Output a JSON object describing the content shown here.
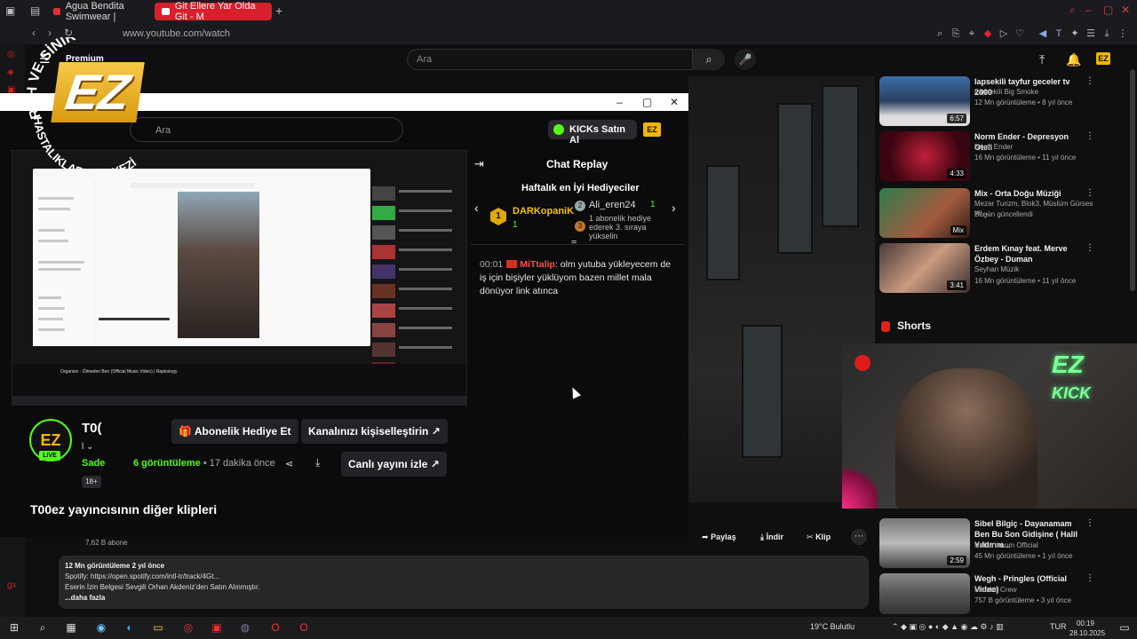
{
  "browser": {
    "tabs": [
      {
        "label": "Agua Bendita Swimwear |"
      },
      {
        "label": "Git Ellere Yar Olda Git - M"
      }
    ],
    "url": "www.youtube.com/watch"
  },
  "youtube": {
    "search_placeholder": "Ara",
    "premium_label": "Premium",
    "recommendations": [
      {
        "title": "lapsekili tayfur geceler tv 2000",
        "channel": "Lapsekili Big Smoke",
        "meta": "12 Mn görüntüleme • 8 yıl önce",
        "duration": "6:57"
      },
      {
        "title": "Norm Ender - Depresyon Oteli",
        "channel": "Norm Ender",
        "meta": "16 Mn görüntüleme • 11 yıl önce",
        "duration": "4:33"
      },
      {
        "title": "Mix - Orta Doğu Müziği",
        "channel": "Mezar Turizm, Blok3, Müslüm Gürses ve ...",
        "meta": "Bugün güncellendi",
        "duration": "Mix"
      },
      {
        "title": "Erdem Kınay feat. Merve Özbey - Duman",
        "channel": "Seyhan Müzik",
        "meta": "16 Mn görüntüleme • 11 yıl önce",
        "duration": "3:41"
      },
      {
        "title": "Sibel Bilgiç - Dayanamam Ben Bu Son Gidişine ( Halil Yıldırım...",
        "channel": "Halil Yıldırım Official",
        "meta": "45 Mn görüntüleme • 1 yıl önce",
        "duration": "2:59"
      },
      {
        "title": "Wegh - Pringles (Official Video)",
        "channel": "Mamba Crew",
        "meta": "757 B görüntüleme • 3 yıl önce",
        "duration": ""
      }
    ],
    "shorts_label": "Shorts",
    "subscribers": "7,62 B abone",
    "actions": {
      "share": "Paylaş",
      "download": "İndir",
      "clip": "Klip"
    },
    "description": {
      "line1": "12 Mn görüntüleme  2 yıl önce",
      "line2": "Spotify: https://open.spotify.com/intl-tr/track/4Gt...",
      "line3": "Eserin İzin Belgesi Sevgili Orhan Akdeniz'den Satın Alınmıştır.",
      "more": "...daha fazla"
    }
  },
  "logo": {
    "text_top": "RUH VE SİNİR",
    "text_side": "HASTALIKLARI MERKEZİ",
    "mark": "EZ"
  },
  "kick": {
    "search_placeholder": "Ara",
    "kicks_button": "KICKs Satın Al",
    "chat": {
      "title": "Chat Replay",
      "top_gifters_title": "Haftalık en İyi Hediyeciler",
      "gifter1": {
        "rank": "1",
        "name": "DARKopaniK",
        "count": "1"
      },
      "gifter2": {
        "rank": "2",
        "name": "Ali_eren24",
        "count": "1"
      },
      "gifter3": {
        "rank": "3",
        "text": "1 abonelik hediye ederek 3. sıraya yükselin"
      },
      "message": {
        "time": "00:01",
        "user": "MiTtalip",
        "text": ": olm yutuba yükleyecem de iş için bişiyler yüklüyom bazen millet mala dönüyor link atınca"
      }
    },
    "channel": {
      "name": "T0(",
      "sub_label": "l",
      "status": "Sade",
      "live": "LIVE",
      "age": "18+"
    },
    "gift_sub_button": "Abonelik Hediye Et",
    "customize_button": "Kanalınızı kişiselleştirin",
    "watch_live_button": "Canlı yayını izle",
    "views_count": "6 görüntüleme",
    "time_ago": " • 17 dakika önce",
    "clips_title": "T00ez yayıncısının diğer klipleri",
    "preview_caption": "Organize - Ölmeden Ben (Official Music Video) | Rapkology"
  },
  "webcam": {
    "neon_top": "EZ",
    "neon_bottom": "KICK"
  },
  "taskbar": {
    "weather": "19°C  Bulutlu",
    "lang": "TUR",
    "time": "00:19",
    "date": "28.10.2025"
  }
}
